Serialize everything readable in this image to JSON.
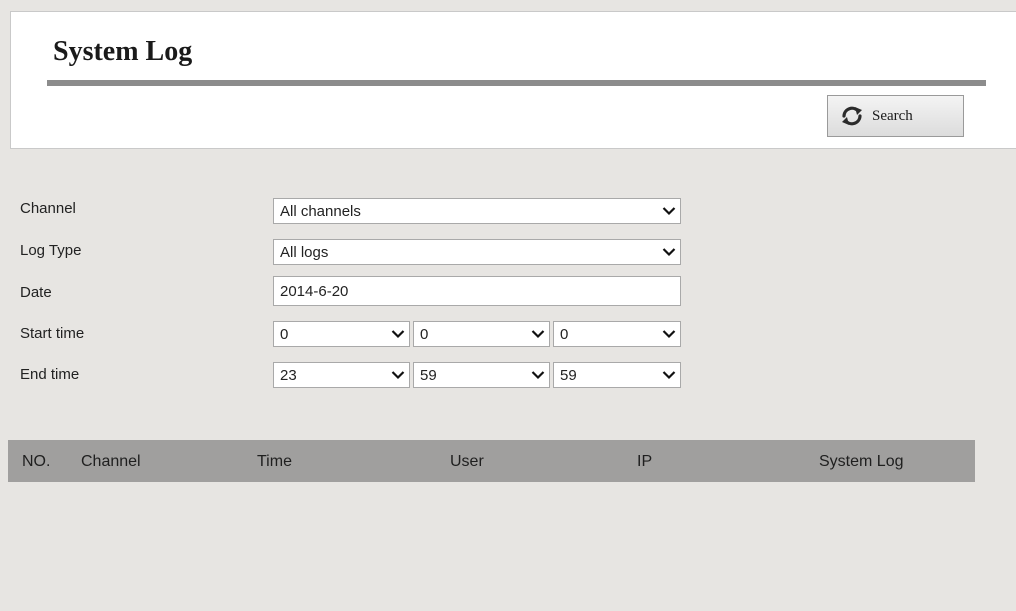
{
  "page": {
    "title": "System Log"
  },
  "toolbar": {
    "search_label": "Search",
    "search_icon": "refresh-icon"
  },
  "form": {
    "channel": {
      "label": "Channel",
      "value": "All channels"
    },
    "log_type": {
      "label": "Log Type",
      "value": "All logs"
    },
    "date": {
      "label": "Date",
      "value": "2014-6-20"
    },
    "start_time": {
      "label": "Start time",
      "hour": "0",
      "minute": "0",
      "second": "0"
    },
    "end_time": {
      "label": "End time",
      "hour": "23",
      "minute": "59",
      "second": "59"
    }
  },
  "table": {
    "columns": [
      "NO.",
      "Channel",
      "Time",
      "User",
      "IP",
      "System Log"
    ],
    "rows": []
  },
  "colors": {
    "background": "#e7e5e2",
    "header_panel": "#ffffff",
    "title_rule": "#8c8c8c",
    "table_header": "#a09f9e"
  }
}
